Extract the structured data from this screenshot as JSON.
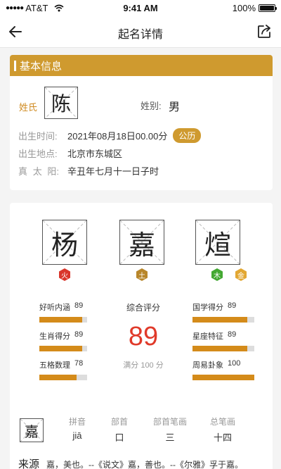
{
  "status_bar": {
    "carrier": "AT&T",
    "time": "9:41 AM",
    "battery": "100%",
    "battery_level": 1.0
  },
  "nav": {
    "title": "起名详情"
  },
  "basic_info": {
    "header": "基本信息",
    "surname_label": "姓氏",
    "surname": "陈",
    "gender_label": "姓别:",
    "gender": "男",
    "birth_time_label": "出生时间:",
    "birth_time": "2021年08月18日00.00分",
    "calendar_badge": "公历",
    "birth_place_label": "出生地点:",
    "birth_place": "北京市东城区",
    "true_sun_label_chars": [
      "真",
      "太",
      "阳:"
    ],
    "true_sun": "辛丑年七月十一日子时"
  },
  "name": {
    "characters": [
      "杨",
      "嘉",
      "煊"
    ],
    "elements": [
      {
        "label": "火",
        "color": "#d9362b"
      },
      {
        "label": "土",
        "color": "#b8862b"
      },
      {
        "label": "木",
        "color": "#43a832"
      },
      {
        "label": "金",
        "color": "#e2a733"
      }
    ]
  },
  "scores": {
    "left": [
      {
        "label": "好听内涵",
        "value": "89",
        "fraction": 0.89
      },
      {
        "label": "生肖得分",
        "value": "89",
        "fraction": 0.89
      },
      {
        "label": "五格数理",
        "value": "78",
        "fraction": 0.78
      }
    ],
    "right": [
      {
        "label": "国学得分",
        "value": "89",
        "fraction": 0.89
      },
      {
        "label": "星座特征",
        "value": "89",
        "fraction": 0.89
      },
      {
        "label": "周易卦象",
        "value": "100",
        "fraction": 1.0
      }
    ],
    "overall_label": "综合评分",
    "overall_value": "89",
    "overall_max": "满分 100 分"
  },
  "char_detail": {
    "character": "嘉",
    "pinyin_label": "拼音",
    "pinyin": "jiā",
    "radical_label": "部首",
    "radical": "口",
    "radical_strokes_label": "部首笔画",
    "radical_strokes": "三",
    "total_strokes_label": "总笔画",
    "total_strokes": "十四",
    "origin_label": "来源",
    "origin_text": "嘉，美也。--《说文》嘉，善也。--《尔雅》孚于嘉。"
  },
  "colors": {
    "accent": "#cf9a2f",
    "bar_fill": "#d48b1a",
    "score": "#e03a2a"
  }
}
